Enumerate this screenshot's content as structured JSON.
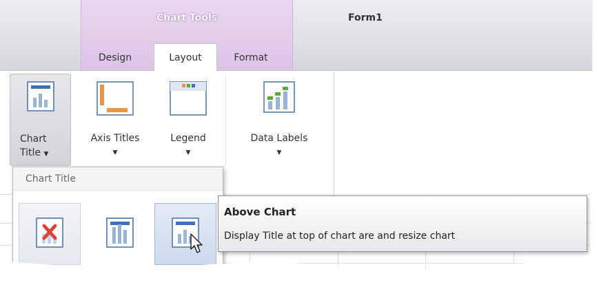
{
  "window": {
    "context_group_title": "Chart Tools",
    "form_title": "Form1"
  },
  "tabs": [
    {
      "label": "Design",
      "selected": false
    },
    {
      "label": "Layout",
      "selected": true
    },
    {
      "label": "Format",
      "selected": false
    }
  ],
  "ribbon": {
    "chart_title": {
      "label_line1": "Chart",
      "label_line2": "Title",
      "icon": "chart-title-icon",
      "pressed": true
    },
    "axis_titles": {
      "label": "Axis Titles",
      "icon": "axis-titles-icon"
    },
    "legend": {
      "label": "Legend",
      "icon": "legend-icon"
    },
    "data_labels": {
      "label": "Data Labels",
      "icon": "data-labels-icon"
    },
    "dropdown_arrow": "▼"
  },
  "dropdown": {
    "header": "Chart Title",
    "items": [
      {
        "name": "none",
        "icon": "no-title-icon"
      },
      {
        "name": "centered-overlay",
        "icon": "overlay-title-icon"
      },
      {
        "name": "above-chart",
        "icon": "above-chart-title-icon",
        "hovered": true
      }
    ]
  },
  "tooltip": {
    "title": "Above Chart",
    "description": "Display Title at top of chart are and resize chart"
  },
  "colors": {
    "context_tab_bg": "#dcc3e6",
    "accent_blue": "#3f6fb5",
    "accent_orange": "#e8944a",
    "accent_green": "#5aaa3c",
    "delete_red": "#d9453a"
  }
}
